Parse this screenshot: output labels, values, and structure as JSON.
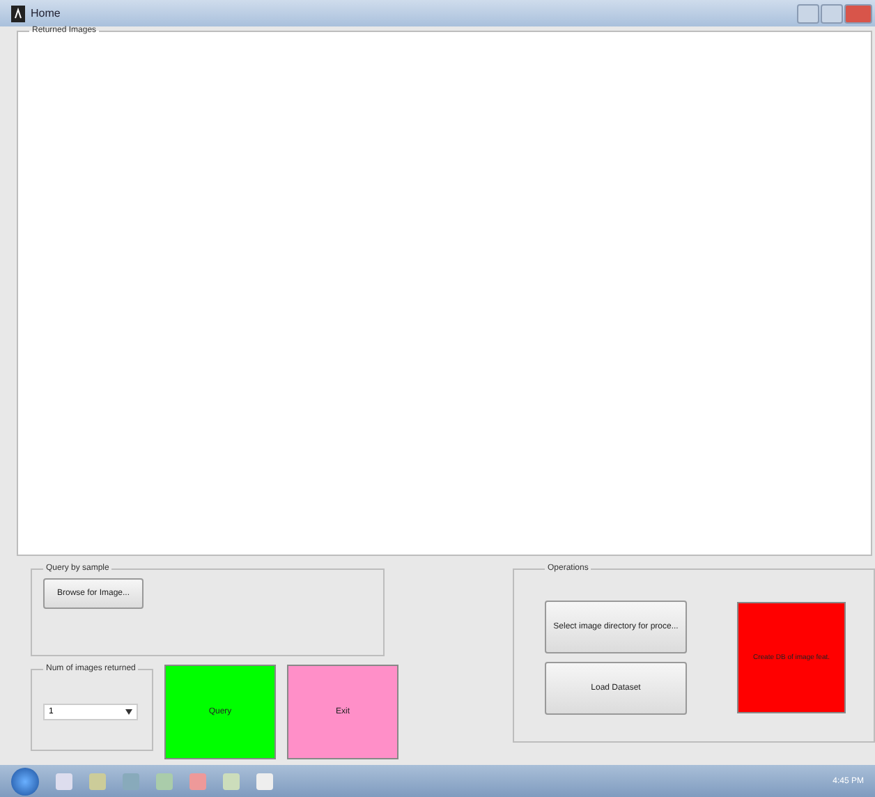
{
  "window": {
    "title": "Home"
  },
  "returned_images": {
    "title": "Returned Images"
  },
  "query_by_sample": {
    "title": "Query by sample",
    "browse_button": "Browse for Image..."
  },
  "num_images": {
    "title": "Num of images returned",
    "value": "1"
  },
  "query_button": "Query",
  "exit_button": "Exit",
  "operations": {
    "title": "Operations",
    "buttons": [
      "Select image directory for proce...",
      "Load Dataset"
    ],
    "red_button": "Create DB of image feat."
  },
  "taskbar": {
    "clock": "4:45 PM"
  }
}
